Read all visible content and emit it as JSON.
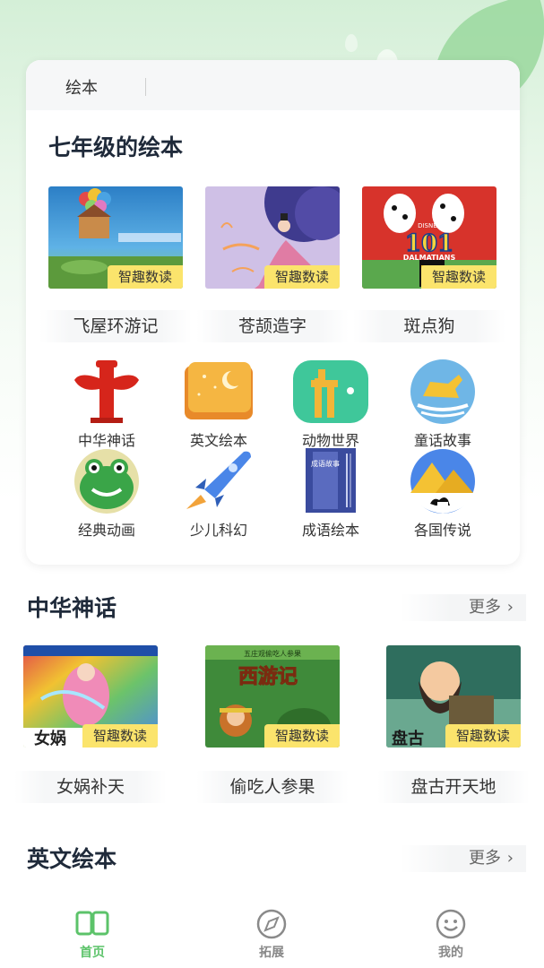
{
  "top_card": {
    "tab_label": "绘本",
    "title": "七年级的绘本",
    "books": [
      {
        "title": "飞屋环游记",
        "tag": "智趣数读"
      },
      {
        "title": "苍颉造字",
        "tag": "智趣数读"
      },
      {
        "title": "斑点狗",
        "tag": "智趣数读",
        "cover_text": "101",
        "cover_sub": "DALMATIANS",
        "cover_brand": "DISNEY"
      }
    ],
    "categories": [
      {
        "label": "中华神话",
        "icon": "red-totem-icon"
      },
      {
        "label": "英文绘本",
        "icon": "storybook-moon-icon"
      },
      {
        "label": "动物世界",
        "icon": "giraffe-icon"
      },
      {
        "label": "童话故事",
        "icon": "rocking-horse-icon"
      },
      {
        "label": "经典动画",
        "icon": "frog-icon"
      },
      {
        "label": "少儿科幻",
        "icon": "rocket-icon"
      },
      {
        "label": "成语绘本",
        "icon": "idiom-book-icon",
        "icon_text": "成语故事"
      },
      {
        "label": "各国传说",
        "icon": "pyramid-camel-icon"
      }
    ]
  },
  "section_myth": {
    "title": "中华神话",
    "more": "更多",
    "books": [
      {
        "title": "女娲补天",
        "tag": "智趣数读",
        "cover_text": "女娲"
      },
      {
        "title": "偷吃人参果",
        "tag": "智趣数读",
        "cover_text": "西游记",
        "cover_top": "五庄观偷吃人参果"
      },
      {
        "title": "盘古开天地",
        "tag": "智趣数读",
        "cover_text": "盘古"
      }
    ]
  },
  "section_english": {
    "title": "英文绘本",
    "more": "更多"
  },
  "navbar": {
    "items": [
      {
        "label": "首页",
        "icon": "book-open-icon",
        "active": true
      },
      {
        "label": "拓展",
        "icon": "compass-icon",
        "active": false
      },
      {
        "label": "我的",
        "icon": "smiley-icon",
        "active": false
      }
    ]
  },
  "colors": {
    "accent_green": "#5cc36a",
    "tag_yellow": "#fbe46c",
    "title_dark": "#1f2a3a"
  }
}
